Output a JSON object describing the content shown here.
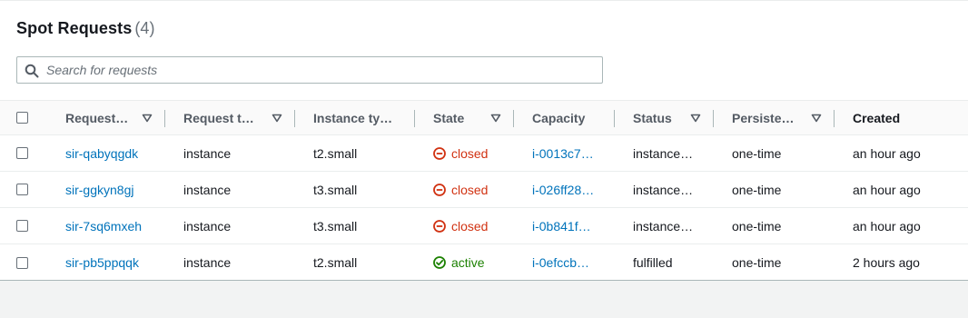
{
  "header": {
    "title": "Spot Requests",
    "count": "(4)"
  },
  "search": {
    "placeholder": "Search for requests",
    "value": ""
  },
  "columns": [
    {
      "key": "request_id",
      "label": "Request…"
    },
    {
      "key": "request_type",
      "label": "Request t…"
    },
    {
      "key": "instance_type",
      "label": "Instance ty…"
    },
    {
      "key": "state",
      "label": "State"
    },
    {
      "key": "capacity",
      "label": "Capacity"
    },
    {
      "key": "status",
      "label": "Status"
    },
    {
      "key": "persistence",
      "label": "Persiste…"
    },
    {
      "key": "created",
      "label": "Created"
    }
  ],
  "rows": [
    {
      "request_id": "sir-qabyqgdk",
      "request_type": "instance",
      "instance_type": "t2.small",
      "state": "closed",
      "capacity": "i-0013c7…",
      "status": "instance…",
      "persistence": "one-time",
      "created": "an hour ago"
    },
    {
      "request_id": "sir-ggkyn8gj",
      "request_type": "instance",
      "instance_type": "t3.small",
      "state": "closed",
      "capacity": "i-026ff28…",
      "status": "instance…",
      "persistence": "one-time",
      "created": "an hour ago"
    },
    {
      "request_id": "sir-7sq6mxeh",
      "request_type": "instance",
      "instance_type": "t3.small",
      "state": "closed",
      "capacity": "i-0b841f…",
      "status": "instance…",
      "persistence": "one-time",
      "created": "an hour ago"
    },
    {
      "request_id": "sir-pb5ppqqk",
      "request_type": "instance",
      "instance_type": "t2.small",
      "state": "active",
      "capacity": "i-0efccb…",
      "status": "fulfilled",
      "persistence": "one-time",
      "created": "2 hours ago"
    }
  ],
  "colors": {
    "link": "#0073bb",
    "closed": "#d13212",
    "active": "#1d8102",
    "header_text": "#545b64"
  },
  "icons": {
    "search": "search-icon",
    "sort": "caret-down-icon",
    "closed": "circle-minus-icon",
    "active": "circle-check-icon"
  }
}
